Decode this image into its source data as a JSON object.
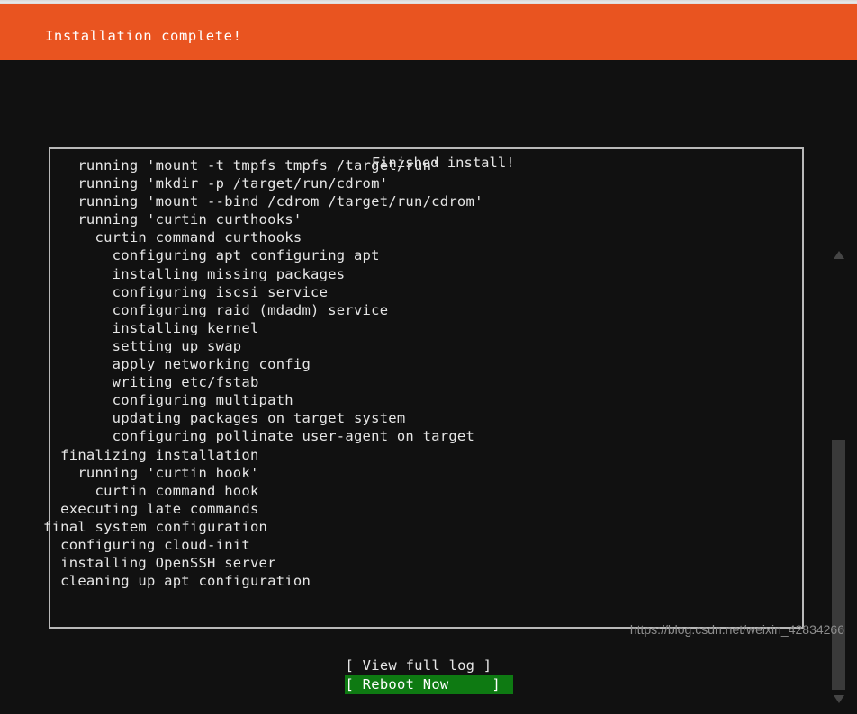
{
  "window": {
    "header_title": "Installation complete!",
    "header_color": "#e95420",
    "background_color": "#111111",
    "text_color": "#e6e6e6"
  },
  "log_box": {
    "title": "Finished install!",
    "border_color": "#b9b9b9",
    "lines": [
      "    running 'mount -t tmpfs tmpfs /target/run'",
      "    running 'mkdir -p /target/run/cdrom'",
      "    running 'mount --bind /cdrom /target/run/cdrom'",
      "    running 'curtin curthooks'",
      "      curtin command curthooks",
      "        configuring apt configuring apt",
      "        installing missing packages",
      "        configuring iscsi service",
      "        configuring raid (mdadm) service",
      "        installing kernel",
      "        setting up swap",
      "        apply networking config",
      "        writing etc/fstab",
      "        configuring multipath",
      "        updating packages on target system",
      "        configuring pollinate user-agent on target",
      "  finalizing installation",
      "    running 'curtin hook'",
      "      curtin command hook",
      "  executing late commands",
      "final system configuration",
      "  configuring cloud-init",
      "  installing OpenSSH server",
      "  cleaning up apt configuration"
    ]
  },
  "scrollbar": {
    "up_arrow": "scroll-up-arrow",
    "down_arrow": "scroll-down-arrow",
    "thumb_color": "#3a3a3a",
    "arrow_color": "#454545"
  },
  "buttons": {
    "view_log": "[ View full log ]",
    "reboot": "[ Reboot Now     ]",
    "reboot_selected": true,
    "selected_color": "#0e7a12"
  },
  "watermark": {
    "text": "https://blog.csdn.net/weixin_42834266",
    "color": "#8d8d8d"
  }
}
